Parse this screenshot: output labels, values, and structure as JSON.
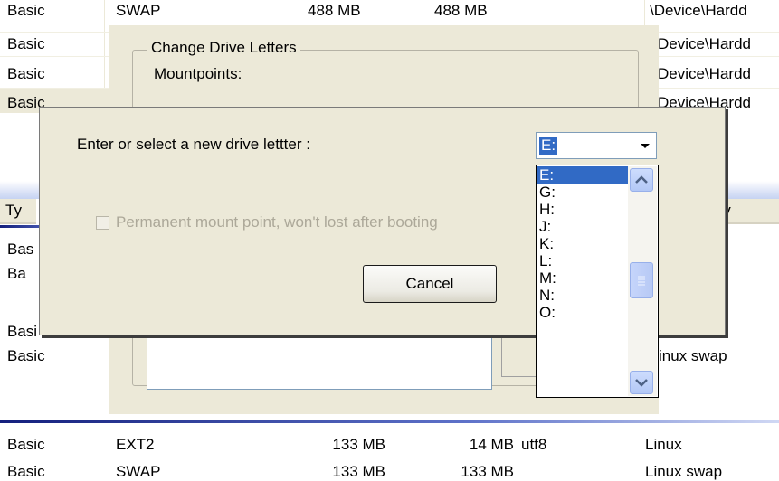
{
  "background_list": {
    "rows_top": [
      {
        "type": "Basic",
        "fs": "SWAP",
        "size": "488 MB",
        "used": "488 MB",
        "extra": "",
        "entry": "\\Device\\Hardd"
      },
      {
        "type": "Basic",
        "entry": "Device\\Hardd"
      },
      {
        "type": "Basic",
        "entry": "Device\\Hardd"
      },
      {
        "type": "Basic",
        "entry": "Device\\Hardd"
      }
    ],
    "header": {
      "type": "Ty",
      "entry": "entry"
    },
    "rows_mid": [
      {
        "type": "Bas"
      },
      {
        "type": "Ba"
      },
      {
        "type": "Basi"
      },
      {
        "type": "Basic",
        "entry": "inux swap"
      }
    ],
    "rows_bottom": [
      {
        "type": "Basic",
        "fs": "EXT2",
        "size": "133 MB",
        "used": "14 MB",
        "extra": "utf8",
        "entry": "Linux"
      },
      {
        "type": "Basic",
        "fs": "SWAP",
        "size": "133 MB",
        "used": "133 MB",
        "extra": "",
        "entry": "Linux swap"
      }
    ],
    "row_fragment": "o"
  },
  "change_drive_dialog": {
    "group_title": "Change Drive Letters",
    "mountpoints_label": "Mountpoints:"
  },
  "drive_letter_dialog": {
    "prompt": "Enter or select a new drive lettter :",
    "permanent_checkbox_label": "Permanent mount point, won't lost after booting",
    "permanent_checked": false,
    "cancel_label": "Cancel",
    "combo_value": "E:",
    "options": [
      "E:",
      "G:",
      "H:",
      "J:",
      "K:",
      "L:",
      "M:",
      "N:",
      "O:"
    ],
    "selected_option": "E:"
  },
  "colors": {
    "dialog_bg": "#ece9d8",
    "selection": "#316ac5",
    "scrollbar_blue": "#b3c8f6"
  }
}
